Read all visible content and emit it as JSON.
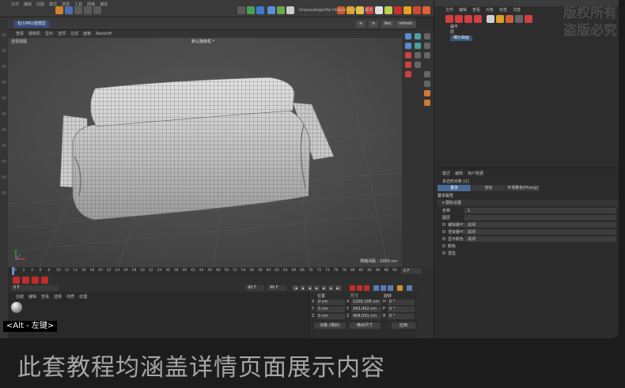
{
  "top_menu": {
    "items": [
      "文件",
      "编辑",
      "创建",
      "模式",
      "选择",
      "工具",
      "网格",
      "捕捉",
      "动画",
      "模拟",
      "跟踪器",
      "渲染",
      "扩展",
      "窗口",
      "帮助"
    ],
    "plugins": [
      "Greyscalegorilla",
      "Octane",
      "Redshift",
      "脚本"
    ]
  },
  "viewport_header": {
    "object_tag": "包(UMG)建模型",
    "buttons": [
      "≡",
      "≡",
      "Rec",
      "refresh"
    ]
  },
  "viewport_menu": [
    "查看",
    "摄像机",
    "显示",
    "选项",
    "过滤",
    "面板",
    "Redshift"
  ],
  "viewport": {
    "view_name": "透视视图",
    "camera": "默认摄像机 *",
    "grid_spacing": "网格间距 : 1000 cm"
  },
  "object_manager": {
    "menu": [
      "文件",
      "编辑",
      "查看",
      "对象",
      "标签",
      "书签"
    ],
    "rows": [
      "扁平",
      "层"
    ],
    "selected_row": "细分曲面"
  },
  "watermark": [
    "版权所有",
    "盗版必究"
  ],
  "attribute_manager": {
    "menu": [
      "模式",
      "编辑",
      "用户数据"
    ],
    "title": "多边形对象 [1]",
    "tabs": [
      "基本",
      "坐标",
      "平滑着色(Phong)"
    ],
    "section": "基本属性",
    "subsection": "▾ 图标设置",
    "fields": [
      {
        "label": "名称",
        "value": "1"
      },
      {
        "label": "图层",
        "value": ""
      },
      {
        "label": "编辑器可见",
        "value": "关闭"
      },
      {
        "label": "渲染器可见",
        "value": "关闭"
      },
      {
        "label": "显示颜色",
        "value": "关闭"
      },
      {
        "label": "颜色",
        "value": ""
      },
      {
        "label": "透显",
        "value": ""
      }
    ]
  },
  "timeline": {
    "ticks": [
      "0",
      "2",
      "4",
      "6",
      "8",
      "10",
      "12",
      "14",
      "16",
      "18",
      "20",
      "22",
      "24",
      "26",
      "28",
      "30",
      "32",
      "34",
      "36",
      "38",
      "40",
      "42",
      "44",
      "46",
      "48",
      "50",
      "52",
      "54",
      "56",
      "58",
      "60",
      "62",
      "64",
      "66",
      "68",
      "70",
      "72",
      "74",
      "76",
      "78",
      "80",
      "82",
      "84",
      "86",
      "88",
      "90"
    ],
    "current": "0 F",
    "start": "0 F",
    "end": "90 F",
    "end2": "90 F"
  },
  "material_menu": [
    "创建",
    "编辑",
    "查看",
    "选择",
    "材质",
    "纹理"
  ],
  "coordinates": {
    "headers": [
      "位置",
      "尺寸",
      "旋转"
    ],
    "rows": [
      {
        "axis": "X",
        "pos": "0 cm",
        "size": "1209.106 cm",
        "rot_label": "H",
        "rot": "0 °"
      },
      {
        "axis": "Y",
        "pos": "0 cm",
        "size": "343.452 cm",
        "rot_label": "P",
        "rot": "0 °"
      },
      {
        "axis": "Z",
        "pos": "0 cm",
        "size": "468.031 cm",
        "rot_label": "B",
        "rot": "0 °"
      }
    ],
    "mode": "对象 (相对)",
    "size_mode": "绝对尺寸",
    "apply": "应用"
  },
  "shortcut_hint": "<Alt - 左键>",
  "caption": "此套教程均涵盖详情页面展示内容",
  "colors": {
    "accent_blue": "#394e7a",
    "selection": "#4a6b9a",
    "key_red": "#c42b2b",
    "background": "#1c1c1c"
  }
}
